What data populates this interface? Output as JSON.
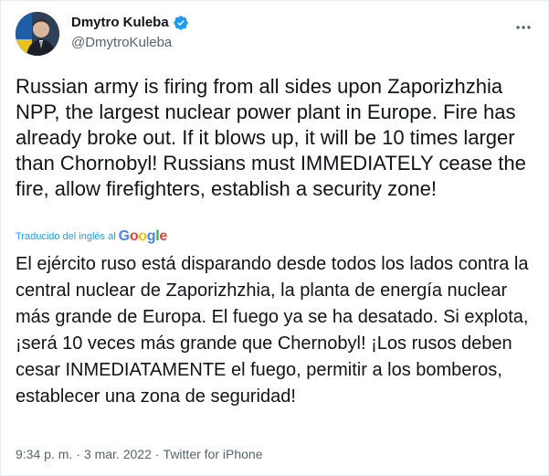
{
  "author": {
    "display_name": "Dmytro Kuleba",
    "handle": "@DmytroKuleba",
    "verified": true,
    "avatar_icon": "avatar-portrait"
  },
  "tweet": {
    "text": "Russian army is firing from all sides upon Zaporizhzhia NPP, the largest nuclear power plant in Europe. Fire has already broke out. If it blows up, it will be 10 times larger than Chornobyl! Russians must IMMEDIATELY cease the fire, allow firefighters, establish a security zone!"
  },
  "translation": {
    "label": "Traducido del inglés al",
    "provider": "Google",
    "text": "El ejército ruso está disparando desde todos los lados contra la central nuclear de Zaporizhzhia, la planta de energía nuclear más grande de Europa. El fuego ya se ha desatado. Si explota, ¡será 10 veces más grande que Chernobyl! ¡Los rusos deben cesar INMEDIATAMENTE el fuego, permitir a los bomberos, establecer una zona de seguridad!"
  },
  "meta": {
    "time": "9:34 p. m.",
    "separator": "·",
    "date": "3 mar. 2022",
    "source": "Twitter for iPhone"
  },
  "colors": {
    "verified": "#1d9bf0",
    "link": "#1d9bf0",
    "secondary_text": "#536471",
    "primary_text": "#0f1419",
    "google_blue": "#4285f4",
    "google_red": "#ea4335",
    "google_yellow": "#fbbc05",
    "google_green": "#34a853"
  }
}
